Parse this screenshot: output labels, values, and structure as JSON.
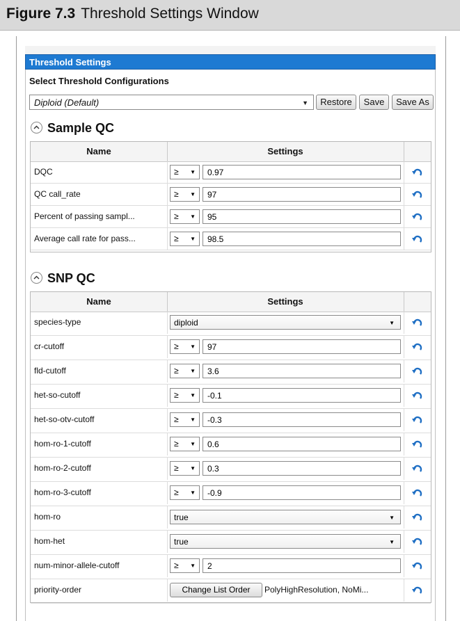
{
  "figure": {
    "number": "Figure 7.3",
    "caption": "Threshold Settings Window"
  },
  "window": {
    "title": "Threshold Settings"
  },
  "config": {
    "label": "Select Threshold Configurations",
    "selected": "Diploid (Default)",
    "buttons": {
      "restore": "Restore",
      "save": "Save",
      "save_as": "Save As"
    }
  },
  "columns": {
    "name": "Name",
    "settings": "Settings"
  },
  "sample_qc": {
    "title": "Sample QC",
    "rows": [
      {
        "name": "DQC",
        "op": "≥",
        "value": "0.97"
      },
      {
        "name": "QC call_rate",
        "op": "≥",
        "value": "97"
      },
      {
        "name": "Percent of passing sampl...",
        "op": "≥",
        "value": "95"
      },
      {
        "name": "Average call rate for pass...",
        "op": "≥",
        "value": "98.5"
      }
    ]
  },
  "snp_qc": {
    "title": "SNP QC",
    "rows": [
      {
        "name": "species-type",
        "select": "diploid"
      },
      {
        "name": "cr-cutoff",
        "op": "≥",
        "value": "97"
      },
      {
        "name": "fld-cutoff",
        "op": "≥",
        "value": "3.6"
      },
      {
        "name": "het-so-cutoff",
        "op": "≥",
        "value": "-0.1"
      },
      {
        "name": "het-so-otv-cutoff",
        "op": "≥",
        "value": "-0.3"
      },
      {
        "name": "hom-ro-1-cutoff",
        "op": "≥",
        "value": "0.6"
      },
      {
        "name": "hom-ro-2-cutoff",
        "op": "≥",
        "value": "0.3"
      },
      {
        "name": "hom-ro-3-cutoff",
        "op": "≥",
        "value": "-0.9"
      },
      {
        "name": "hom-ro",
        "select": "true"
      },
      {
        "name": "hom-het",
        "select": "true"
      },
      {
        "name": "num-minor-allele-cutoff",
        "op": "≥",
        "value": "2"
      },
      {
        "name": "priority-order",
        "button": "Change List Order",
        "text": "PolyHighResolution, NoMi..."
      }
    ]
  },
  "colors": {
    "titlebar": "#1e7ad2",
    "undo_icon": "#1f6fc4"
  }
}
